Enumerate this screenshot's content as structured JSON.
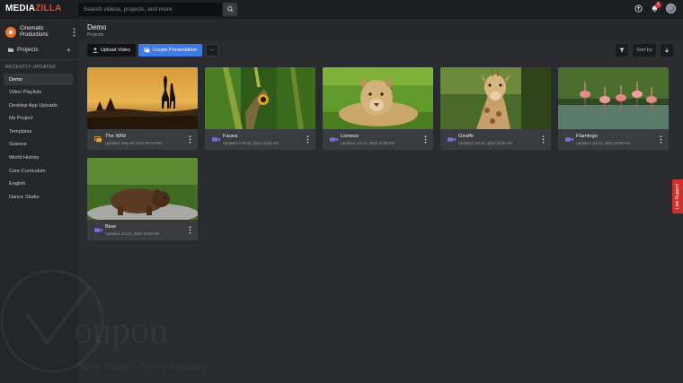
{
  "app": {
    "logo_part1": "MEDIA",
    "logo_part2": "ZILLA",
    "search_placeholder": "Search videos, projects, and more",
    "notification_count": "1"
  },
  "sidebar": {
    "org_name": "Cinematic Productions",
    "projects_label": "Projects",
    "recent_header": "RECENTLY UPDATED",
    "items": [
      {
        "label": "Demo",
        "active": true
      },
      {
        "label": "Video Playlists"
      },
      {
        "label": "Desktop App Uploads"
      },
      {
        "label": "My Project"
      },
      {
        "label": "Templates"
      },
      {
        "label": "Science"
      },
      {
        "label": "World History"
      },
      {
        "label": "Core Curriculum"
      },
      {
        "label": "English"
      },
      {
        "label": "Dance Studio"
      }
    ]
  },
  "header": {
    "title": "Demo",
    "subtitle": "Projects"
  },
  "toolbar": {
    "upload_label": "Upload Video",
    "present_label": "Create Presentation",
    "more_label": "···",
    "sort_label": "Sort by"
  },
  "cards": [
    {
      "title": "The Wild",
      "date": "Updated: May 30, 2023 05:15 PM"
    },
    {
      "title": "Fauna",
      "date": "Updated: Feb 02, 2023 10:43 AM"
    },
    {
      "title": "Lioness",
      "date": "Updated: Jul 13, 2022 10:08 AM"
    },
    {
      "title": "Giraffe",
      "date": "Updated: Jul 13, 2022 10:06 AM"
    },
    {
      "title": "Flamingo",
      "date": "Updated: Jul 13, 2022 10:08 AM"
    },
    {
      "title": "Bear",
      "date": "Updated: Jul 13, 2022 10:08 AM"
    }
  ],
  "live_support": "Live Support",
  "watermark": {
    "text": "oupon",
    "sub": "Save time - Save money"
  },
  "colors": {
    "accent": "#3d7ae8",
    "brand": "#e8482e",
    "live": "#d0302a"
  }
}
